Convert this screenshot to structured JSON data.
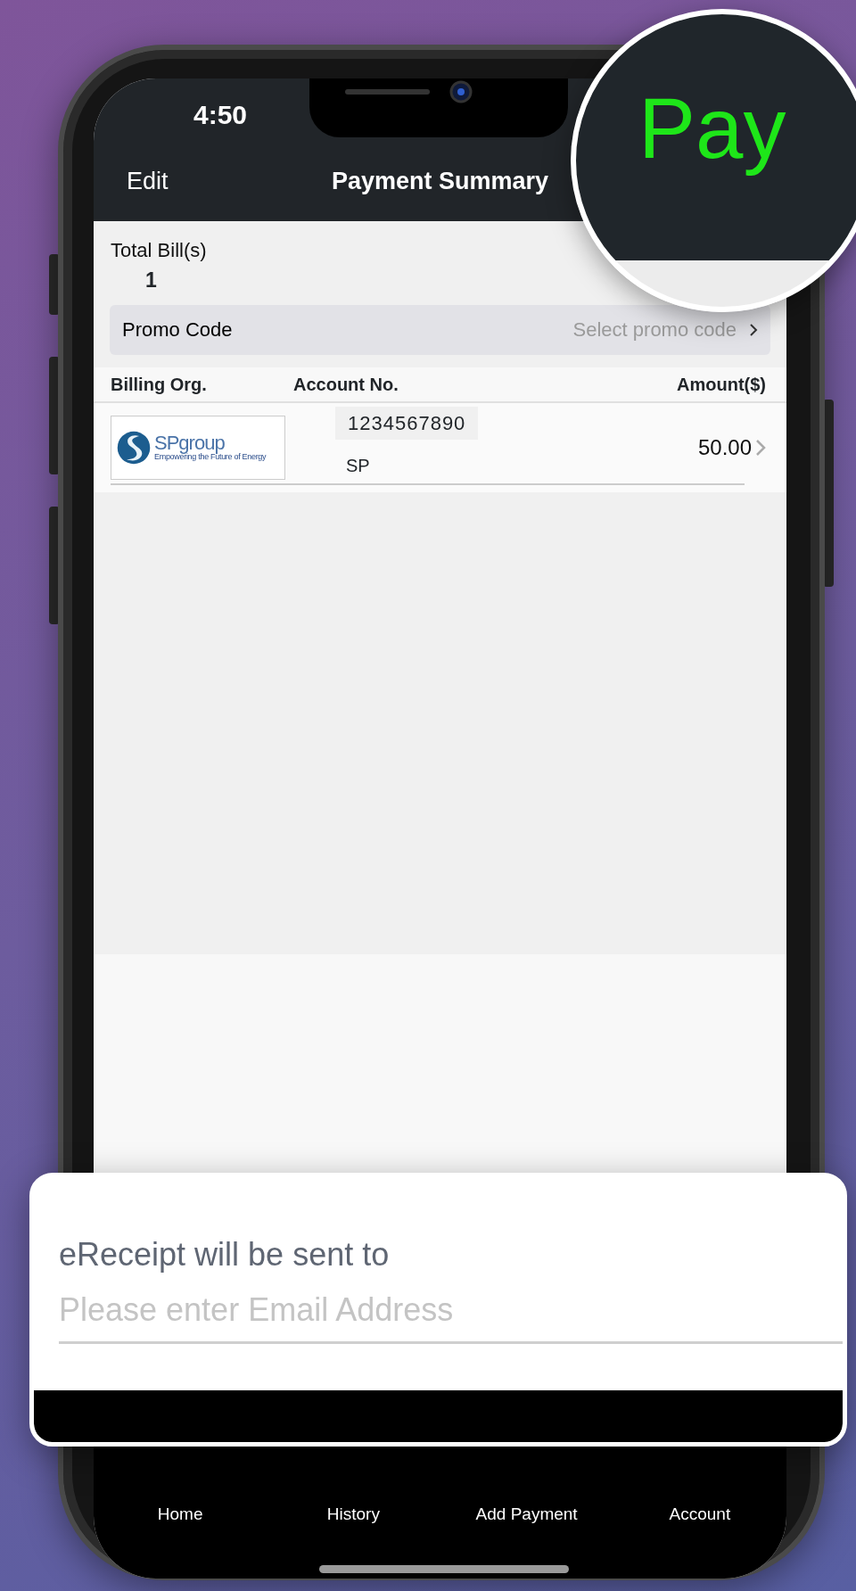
{
  "status_bar": {
    "time": "4:50"
  },
  "nav_bar": {
    "left_button": "Edit",
    "title": "Payment Summary"
  },
  "magnifier": {
    "text": "Pay"
  },
  "summary": {
    "label": "Total Bill(s)",
    "count": "1"
  },
  "promo": {
    "label": "Promo Code",
    "placeholder": "Select promo code"
  },
  "table": {
    "columns": [
      "Billing Org.",
      "Account No.",
      "Amount($)"
    ],
    "rows": [
      {
        "logo_name": "SPgroup",
        "logo_tagline": "Empowering the Future of Energy",
        "account_no": "1234567890",
        "account_name": "SP",
        "amount": "50.00"
      }
    ]
  },
  "receipt": {
    "label": "eReceipt will be sent to",
    "email_placeholder": "Please enter Email Address"
  },
  "tab_bar": [
    {
      "label": "Home"
    },
    {
      "label": "History"
    },
    {
      "label": "Add Payment"
    },
    {
      "label": "Account"
    }
  ]
}
